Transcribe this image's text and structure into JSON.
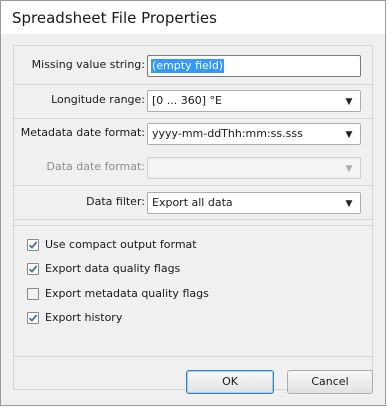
{
  "window": {
    "title": "Spreadsheet File Properties"
  },
  "fields": {
    "missing_value": {
      "label": "Missing value string:",
      "value": "(empty field)"
    },
    "longitude_range": {
      "label": "Longitude range:",
      "value": "[0 ... 360] °E"
    },
    "metadata_date_format": {
      "label": "Metadata date format:",
      "value": "yyyy-mm-ddThh:mm:ss.sss"
    },
    "data_date_format": {
      "label": "Data date format:",
      "value": ""
    },
    "data_filter": {
      "label": "Data filter:",
      "value": "Export all data"
    }
  },
  "options": [
    {
      "label": "Use compact output format",
      "checked": true
    },
    {
      "label": "Export data quality flags",
      "checked": true
    },
    {
      "label": "Export metadata quality flags",
      "checked": false
    },
    {
      "label": "Export history",
      "checked": true
    }
  ],
  "buttons": {
    "ok": "OK",
    "cancel": "Cancel"
  },
  "colors": {
    "accent": "#3399ff",
    "check": "#3d6fb5"
  }
}
